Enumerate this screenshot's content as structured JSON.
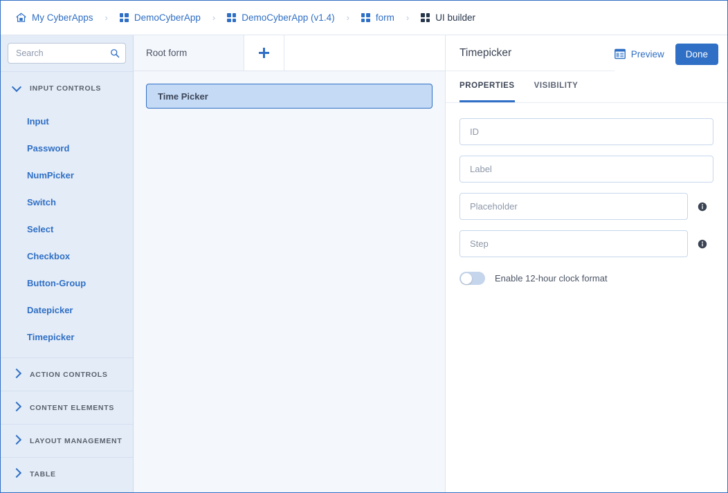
{
  "breadcrumb": {
    "items": [
      {
        "label": "My CyberApps",
        "icon": "home-icon",
        "current": false
      },
      {
        "label": "DemoCyberApp",
        "icon": "grid-icon",
        "current": false
      },
      {
        "label": "DemoCyberApp (v1.4)",
        "icon": "grid-icon",
        "current": false
      },
      {
        "label": "form",
        "icon": "grid-icon",
        "current": false
      },
      {
        "label": "UI builder",
        "icon": "grid-icon",
        "current": true
      }
    ],
    "separator": "›"
  },
  "sidebar": {
    "search": {
      "placeholder": "Search",
      "value": "",
      "icon": "search-icon"
    },
    "sections": [
      {
        "title": "INPUT CONTROLS",
        "expanded": true,
        "items": [
          "Input",
          "Password",
          "NumPicker",
          "Switch",
          "Select",
          "Checkbox",
          "Button-Group",
          "Datepicker",
          "Timepicker"
        ]
      },
      {
        "title": "ACTION CONTROLS",
        "expanded": false,
        "items": []
      },
      {
        "title": "CONTENT ELEMENTS",
        "expanded": false,
        "items": []
      },
      {
        "title": "LAYOUT MANAGEMENT",
        "expanded": false,
        "items": []
      },
      {
        "title": "TABLE",
        "expanded": false,
        "items": []
      }
    ]
  },
  "center": {
    "tab_label": "Root form",
    "add_tab_icon": "plus-icon",
    "widgets": [
      {
        "label": "Time Picker",
        "selected": true
      }
    ]
  },
  "toolbar": {
    "preview_label": "Preview",
    "preview_icon": "layout-icon",
    "done_label": "Done"
  },
  "properties_panel": {
    "title": "Timepicker",
    "header_icons": [
      "info-circle-icon",
      "trash-icon"
    ],
    "tabs": [
      {
        "label": "PROPERTIES",
        "active": true
      },
      {
        "label": "VISIBILITY",
        "active": false
      }
    ],
    "fields": [
      {
        "name": "id",
        "placeholder": "ID",
        "value": "",
        "info": false
      },
      {
        "name": "label",
        "placeholder": "Label",
        "value": "",
        "info": false
      },
      {
        "name": "placeholder",
        "placeholder": "Placeholder",
        "value": "",
        "info": true
      },
      {
        "name": "step",
        "placeholder": "Step",
        "value": "",
        "info": true
      }
    ],
    "toggle": {
      "label": "Enable 12-hour clock format",
      "on": false
    }
  },
  "colors": {
    "accent": "#2f6fc5",
    "sidebar_bg": "#e4ecf7",
    "canvas_bg": "#f4f7fc",
    "selected_widget_bg": "#c4daf5",
    "text_dark": "#27364b"
  }
}
